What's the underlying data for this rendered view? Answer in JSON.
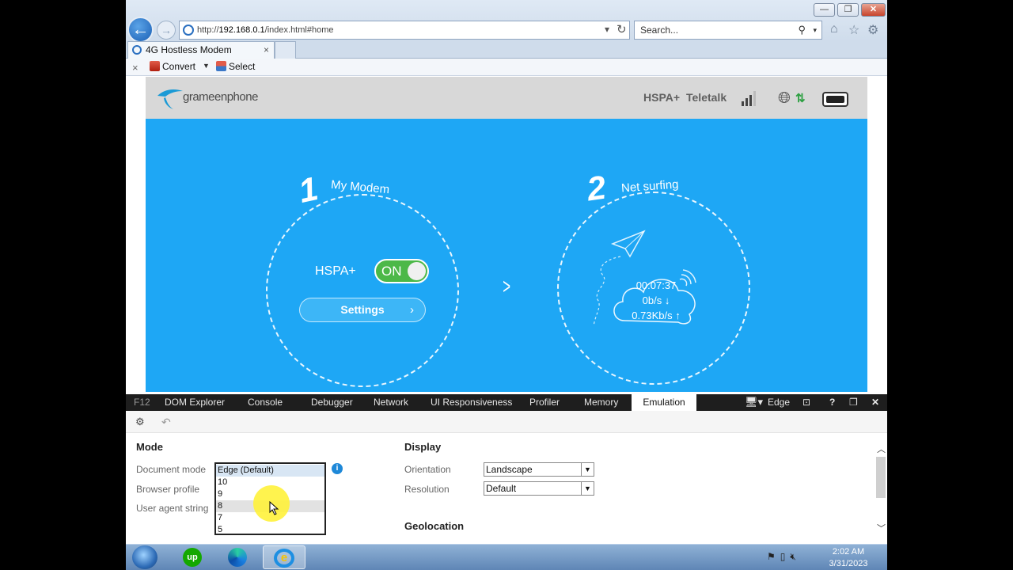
{
  "browser": {
    "url_prefix": "http://",
    "url_host": "192.168.0.1",
    "url_path": "/index.html#home",
    "search_placeholder": "Search...",
    "tab_title": "4G Hostless Modem",
    "tab_close": "×",
    "cmd_close": "×",
    "cmd_convert": "Convert",
    "cmd_select": "Select",
    "btn_minimize": "—",
    "btn_restore": "❐",
    "btn_close": "✕"
  },
  "modem": {
    "brand": "grameenphone",
    "network_type": "HSPA+",
    "operator": "Teletalk",
    "step1_number": "1",
    "step1_label": "My Modem",
    "step2_number": "2",
    "step2_label": "Net surfing",
    "mode_label": "HSPA+",
    "toggle_label": "ON",
    "settings_label": "Settings",
    "duration": "00:07:37",
    "download": "0b/s ↓",
    "upload": "0.73Kb/s ↑",
    "signal_bars": 3
  },
  "devtools": {
    "f12": "F12",
    "tabs": [
      "DOM Explorer",
      "Console",
      "Debugger",
      "Network",
      "UI Responsiveness",
      "Profiler",
      "Memory",
      "Emulation"
    ],
    "active_tab": "Emulation",
    "engine_label": "Edge",
    "mode_title": "Mode",
    "document_mode_label": "Document mode",
    "browser_profile_label": "Browser profile",
    "user_agent_label": "User agent string",
    "document_mode_options": [
      "Edge (Default)",
      "10",
      "9",
      "8",
      "7",
      "5"
    ],
    "display_title": "Display",
    "orientation_label": "Orientation",
    "orientation_value": "Landscape",
    "resolution_label": "Resolution",
    "resolution_value": "Default",
    "geolocation_title": "Geolocation"
  },
  "taskbar": {
    "time": "2:02 AM",
    "date": "3/31/2023",
    "upwork_label": "up"
  }
}
